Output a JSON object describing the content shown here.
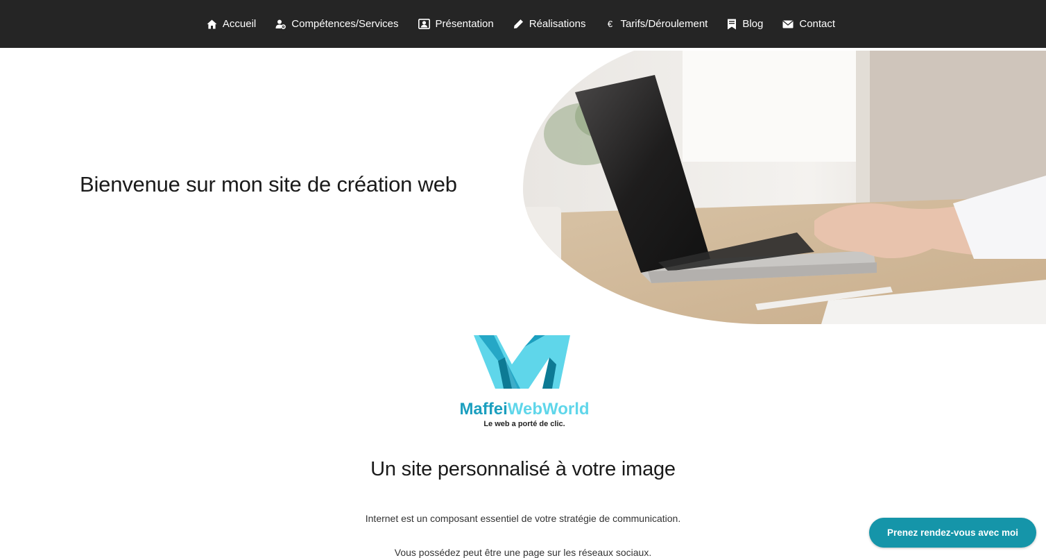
{
  "nav": {
    "items": [
      {
        "label": "Accueil",
        "icon": "home-icon"
      },
      {
        "label": "Compétences/Services",
        "icon": "user-gear-icon"
      },
      {
        "label": "Présentation",
        "icon": "id-card-icon"
      },
      {
        "label": "Réalisations",
        "icon": "pen-icon"
      },
      {
        "label": "Tarifs/Déroulement",
        "icon": "euro-icon"
      },
      {
        "label": "Blog",
        "icon": "bookmark-icon"
      },
      {
        "label": "Contact",
        "icon": "envelope-icon"
      }
    ]
  },
  "hero": {
    "title": "Bienvenue sur mon site de création web",
    "image": "laptop-desk-photo"
  },
  "logo": {
    "wordmark_part1": "Maffei",
    "wordmark_part2": "WebWorld",
    "tagline": "Le web a porté de clic.",
    "colors": {
      "dark": "#1b9fbf",
      "light": "#5fd6ea"
    }
  },
  "section": {
    "title": "Un site personnalisé à votre image",
    "paragraphs": [
      "Internet est un composant essentiel de votre stratégie de communication.",
      "Vous possédez peut être une page sur les réseaux sociaux."
    ]
  },
  "cta": {
    "label": "Prenez rendez-vous avec moi",
    "color": "#1595a9"
  },
  "theme": {
    "nav_bg": "#252525"
  }
}
